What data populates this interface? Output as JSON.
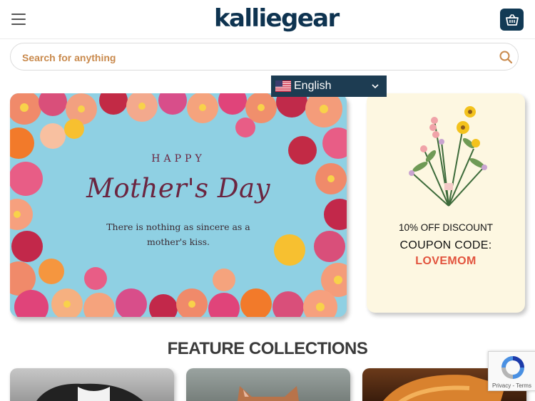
{
  "header": {
    "logo_text": "kalliegear",
    "menu_icon": "hamburger-menu-icon",
    "cart_icon": "basket-icon",
    "brand_color": "#0e3350"
  },
  "search": {
    "placeholder": "Search for anything",
    "value": "",
    "icon": "search-icon",
    "placeholder_color": "#c98a4d"
  },
  "language": {
    "selected": "English",
    "flag_icon": "us-flag-icon",
    "chevron_icon": "chevron-down-icon"
  },
  "banner": {
    "happy": "HAPPY",
    "title": "Mother's Day",
    "subtitle": "There is nothing as sincere as a mother's kiss."
  },
  "coupon": {
    "discount": "10% OFF DISCOUNT",
    "code_label": "COUPON CODE:",
    "code_value": "LOVEMOM",
    "accent_color": "#e2543e"
  },
  "collections": {
    "title": "FEATURE COLLECTIONS",
    "cards": [
      {
        "icon": "dog-photo"
      },
      {
        "icon": "cat-photo"
      },
      {
        "icon": "horse-photo"
      }
    ]
  },
  "recaptcha": {
    "links": "Privacy - Terms",
    "icon": "recaptcha-icon"
  }
}
